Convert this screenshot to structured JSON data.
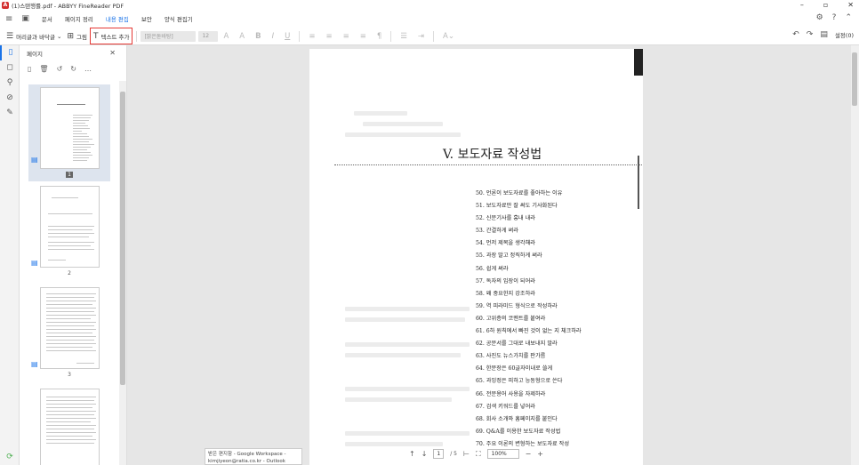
{
  "window": {
    "title": "(1)스탠행률.pdf - ABBYY FineReader PDF",
    "minimize": "–",
    "maximize": "▫",
    "close": "✕"
  },
  "menu": {
    "items": [
      {
        "label": "문서",
        "active": false
      },
      {
        "label": "페이지 정리",
        "active": false
      },
      {
        "label": "내용 편집",
        "active": true
      },
      {
        "label": "보안",
        "active": false
      },
      {
        "label": "양식 편집기",
        "active": false
      }
    ]
  },
  "toolbar": {
    "background_label": "머리글과 바닥글",
    "image_label": "그림",
    "add_text_label": "텍스트 추가",
    "font_family_value": "[맑은돋바탕]",
    "font_size_value": "12",
    "settings_label": "설정(0)"
  },
  "sidebar": {
    "title": "페이지",
    "thumbnails": [
      {
        "page_number": "1",
        "selected": true
      },
      {
        "page_number": "2",
        "selected": false
      },
      {
        "page_number": "3",
        "selected": false
      },
      {
        "page_number": "",
        "selected": false
      }
    ]
  },
  "document": {
    "chapter_title": "V. 보도자료 작성법",
    "toc": [
      "50. 언론이 보도자료를 좋아하는 이유",
      "51. 보도자료만 잘 써도 기사화된다",
      "52. 신문기사를 흉내 내라",
      "53. 간결하게 써라",
      "54. 먼저 제목을 생각해라",
      "55. 과장 말고 정직하게 써라",
      "56. 쉽게 써라",
      "57. 독자의 입장이 되어라",
      "58. 왜 중요한지 강조하라",
      "59. 역 피라미드 형식으로 작성하라",
      "60. 고위층의 코멘트를 붙여라",
      "61. 6하 원칙에서 빠진 것이 없는 지 체크하라",
      "62. 공문서를 그대로 내보내지 말라",
      "63. 사진도 뉴스가치를 판가름",
      "64. 한문장은 60글자이내로 쓸게",
      "65. 과잉정은 피하고 능동형으로 쓴다",
      "66. 전문용어 사용을 자제하라",
      "67. 검색 키워드를 넣어라",
      "68. 회사 소개와 홈페이지를 붙인다",
      "69. Q&A를 이용한 보도자료 작성법",
      "70. 주요 이론의 변형하는 보도자료 작성"
    ]
  },
  "status": {
    "page_current": "1",
    "page_total": "/ 5",
    "zoom": "100%"
  },
  "notification": {
    "line1": "받은 편지함 - Google Workspace -",
    "line2": "kimjiyeon@ratia.co.kr - Outlook"
  }
}
